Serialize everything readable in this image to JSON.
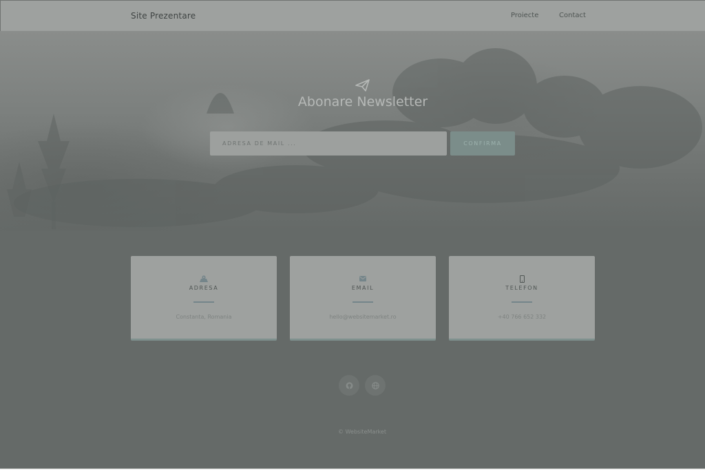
{
  "nav": {
    "brand": "Site Prezentare",
    "links": [
      {
        "label": "Proiecte"
      },
      {
        "label": "Contact"
      }
    ]
  },
  "hero": {
    "icon": "paper-plane-icon",
    "title": "Abonare Newsletter",
    "input_placeholder": "ADRESA DE MAIL ...",
    "input_value": "",
    "button_label": "CONFIRMA"
  },
  "cards": [
    {
      "icon": "map-location-icon",
      "title": "ADRESA",
      "value": "Constanta, Romania"
    },
    {
      "icon": "envelope-icon",
      "title": "EMAIL",
      "value": "hello@websitemarket.ro"
    },
    {
      "icon": "mobile-phone-icon",
      "title": "TELEFON",
      "value": "+40 766 652 332"
    }
  ],
  "social": [
    {
      "icon": "github-icon"
    },
    {
      "icon": "globe-icon"
    }
  ],
  "footer": {
    "copyright": "© WebsiteMarket"
  },
  "colors": {
    "page_bg": "#656a68",
    "navbar_bg": "#9ea19f",
    "accent": "#7b8d8a",
    "card_bg": "#9ea19f"
  }
}
